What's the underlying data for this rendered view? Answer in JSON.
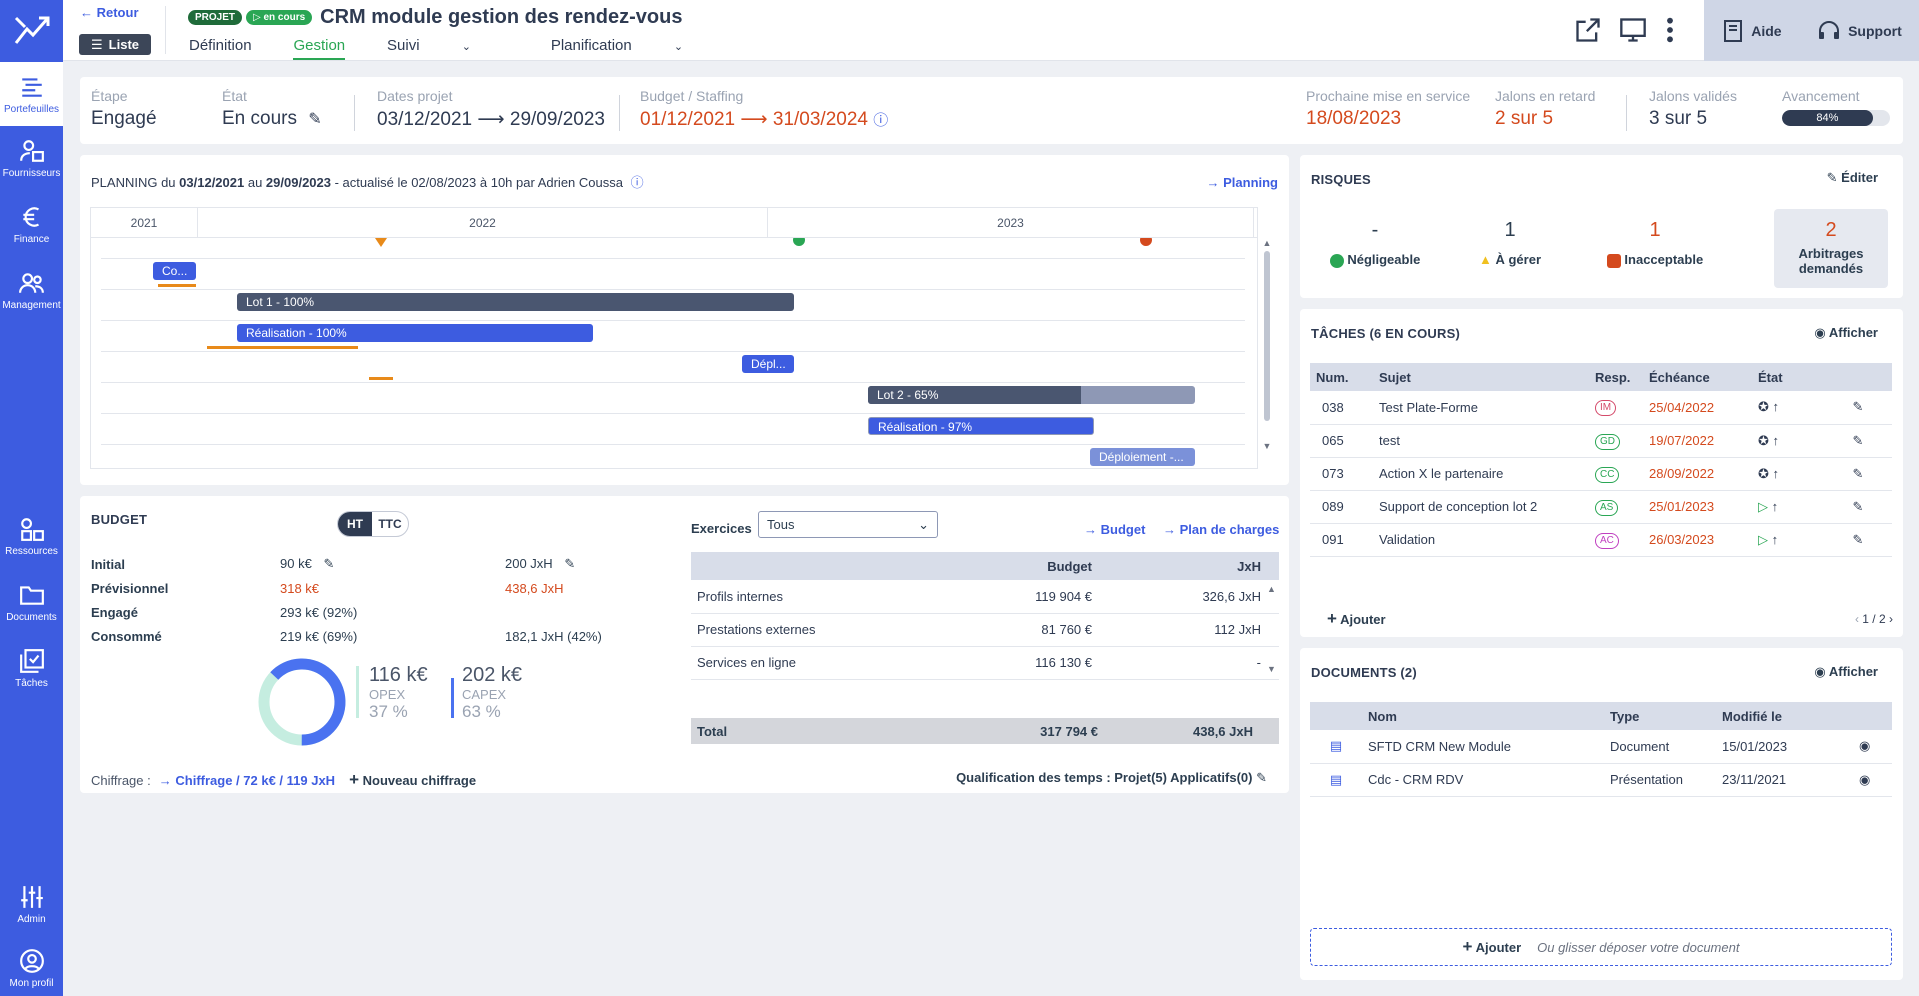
{
  "sidebar": {
    "items": [
      {
        "label": "Portefeuilles",
        "icon": "portfolio-icon"
      },
      {
        "label": "Fournisseurs",
        "icon": "suppliers-icon"
      },
      {
        "label": "Finance",
        "icon": "euro-icon"
      },
      {
        "label": "Management",
        "icon": "people-icon"
      },
      {
        "label": "Ressources",
        "icon": "resources-icon"
      },
      {
        "label": "Documents",
        "icon": "folder-icon"
      },
      {
        "label": "Tâches",
        "icon": "tasks-icon"
      },
      {
        "label": "Admin",
        "icon": "sliders-icon"
      },
      {
        "label": "Mon profil",
        "icon": "user-icon"
      }
    ]
  },
  "header": {
    "back": "← Retour",
    "list": "Liste",
    "tag_project": "PROJET",
    "tag_status": "▷ en cours",
    "title": "CRM module gestion des rendez-vous",
    "tabs": [
      "Définition",
      "Gestion",
      "Suivi",
      "Planification"
    ],
    "help": "Aide",
    "support": "Support"
  },
  "summary": {
    "etape_label": "Étape",
    "etape": "Engagé",
    "etat_label": "État",
    "etat": "En cours",
    "dates_label": "Dates projet",
    "dates": "03/12/2021 ⟶ 29/09/2023",
    "budget_label": "Budget / Staffing",
    "budget_dates": "01/12/2021 ⟶ 31/03/2024",
    "mise_label": "Prochaine mise en service",
    "mise": "18/08/2023",
    "retard_label": "Jalons en retard",
    "retard": "2 sur 5",
    "valides_label": "Jalons validés",
    "valides": "3 sur 5",
    "avancement_label": "Avancement",
    "avancement": "84%",
    "avancement_value": 84
  },
  "planning": {
    "title_pre": "PLANNING du ",
    "date1": "03/12/2021",
    "mid": " au ",
    "date2": "29/09/2023",
    "suffix": " - actualisé le 02/08/2023 à 10h par Adrien Coussa",
    "link": "Planning",
    "years": [
      "2021",
      "2022",
      "2023"
    ],
    "bars": [
      {
        "label": "Co...",
        "progress": 100
      },
      {
        "label": "Lot 1 - 100%",
        "progress": 100
      },
      {
        "label": "Réalisation - 100%",
        "progress": 100
      },
      {
        "label": "Dépl...",
        "progress": 100
      },
      {
        "label": "Lot 2 - 65%",
        "progress": 65
      },
      {
        "label": "Réalisation - 97%",
        "progress": 97
      },
      {
        "label": "Déploiement -...",
        "progress": 0
      }
    ]
  },
  "budget": {
    "title": "BUDGET",
    "ht": "HT",
    "ttc": "TTC",
    "rows": [
      {
        "label": "Initial",
        "v1": "90 k€",
        "v2": "200 JxH"
      },
      {
        "label": "Prévisionnel",
        "v1": "318 k€",
        "v2": "438,6 JxH"
      },
      {
        "label": "Engagé",
        "v1": "293 k€  (92%)",
        "v2": ""
      },
      {
        "label": "Consommé",
        "v1": "219 k€  (69%)",
        "v2": "182,1 JxH  (42%)"
      }
    ],
    "opex_value": "116 k€",
    "opex_label": "OPEX",
    "opex_pct": "37 %",
    "capex_value": "202 k€",
    "capex_label": "CAPEX",
    "capex_pct": "63 %",
    "opex_share": 37,
    "chiffrage_label": "Chiffrage :",
    "chiffrage_link": "Chiffrage / 72 k€ / 119 JxH",
    "nouveau": "Nouveau chiffrage",
    "exercices_label": "Exercices",
    "exercices_value": "Tous",
    "link_budget": "Budget",
    "link_plan": "Plan de charges",
    "table_headers": [
      "",
      "Budget",
      "JxH"
    ],
    "table_rows": [
      {
        "name": "Profils internes",
        "budget": "119 904 €",
        "jxh": "326,6 JxH"
      },
      {
        "name": "Prestations externes",
        "budget": "81 760 €",
        "jxh": "112 JxH"
      },
      {
        "name": "Services en ligne",
        "budget": "116 130 €",
        "jxh": "-"
      }
    ],
    "total": {
      "name": "Total",
      "budget": "317 794 €",
      "jxh": "438,6 JxH"
    },
    "qualif": "Qualification des temps : Projet(5) Applicatifs(0)"
  },
  "risques": {
    "title": "RISQUES",
    "edit": "Éditer",
    "items": [
      {
        "count": "-",
        "label": "Négligeable",
        "color": "#2aa654"
      },
      {
        "count": "1",
        "label": "À gérer",
        "color": "#f0c020"
      },
      {
        "count": "1",
        "label": "Inacceptable",
        "color": "#d44a1e"
      }
    ],
    "arbitrage_count": "2",
    "arbitrage_label": "Arbitrages demandés"
  },
  "taches": {
    "title": "TÂCHES (6 EN COURS)",
    "show": "Afficher",
    "headers": [
      "Num.",
      "Sujet",
      "Resp.",
      "Échéance",
      "État"
    ],
    "rows": [
      {
        "num": "038",
        "sujet": "Test Plate-Forme",
        "resp": "IM",
        "resp_color": "#d44a6a",
        "date": "25/04/2022",
        "state": "star"
      },
      {
        "num": "065",
        "sujet": "test",
        "resp": "GD",
        "resp_color": "#2aa654",
        "date": "19/07/2022",
        "state": "star"
      },
      {
        "num": "073",
        "sujet": "Action X le partenaire",
        "resp": "CC",
        "resp_color": "#2aa654",
        "date": "28/09/2022",
        "state": "star"
      },
      {
        "num": "089",
        "sujet": "Support de conception lot 2",
        "resp": "AS",
        "resp_color": "#2aa654",
        "date": "25/01/2023",
        "state": "play"
      },
      {
        "num": "091",
        "sujet": "Validation",
        "resp": "AC",
        "resp_color": "#c040c0",
        "date": "26/03/2023",
        "state": "play"
      }
    ],
    "add": "Ajouter",
    "pager": "1 / 2"
  },
  "documents": {
    "title": "DOCUMENTS (2)",
    "show": "Afficher",
    "headers": [
      "",
      "Nom",
      "Type",
      "Modifié le",
      ""
    ],
    "rows": [
      {
        "nom": "SFTD CRM New Module",
        "type": "Document",
        "date": "15/01/2023"
      },
      {
        "nom": "Cdc - CRM RDV",
        "type": "Présentation",
        "date": "23/11/2021"
      }
    ],
    "add": "Ajouter",
    "drop": "Ou glisser déposer votre document"
  }
}
